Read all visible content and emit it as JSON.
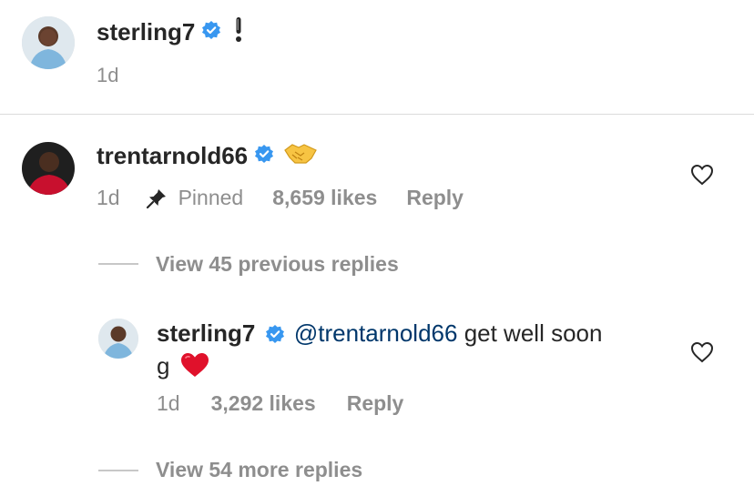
{
  "post": {
    "username": "sterling7",
    "time": "1d",
    "icon": "exclamation-emoji"
  },
  "comment": {
    "username": "trentarnold66",
    "icon": "handshake-emoji",
    "time": "1d",
    "pinned_label": "Pinned",
    "likes": "8,659 likes",
    "reply_label": "Reply",
    "view_previous": "View 45 previous replies"
  },
  "reply": {
    "username": "sterling7",
    "mention": "@trentarnold66",
    "text_1": " get well soon",
    "text_2": "g",
    "icon": "red-heart-emoji",
    "time": "1d",
    "likes": "3,292 likes",
    "reply_label": "Reply",
    "view_more": "View 54 more replies"
  },
  "colors": {
    "text": "#262626",
    "muted": "#8e8e8e",
    "verified": "#3897f0",
    "mention": "#00376b",
    "divider": "#dbdbdb"
  }
}
